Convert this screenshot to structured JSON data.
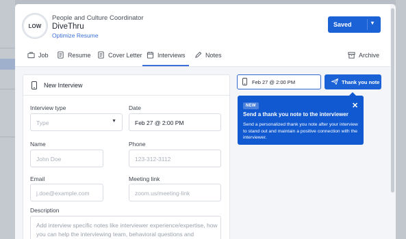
{
  "header": {
    "avatar_text": "LOW",
    "job_title": "People and Culture Coordinator",
    "company": "DiveThru",
    "optimize_link": "Optimize Resume",
    "status_button": "Saved"
  },
  "tabs": [
    {
      "label": "Job",
      "icon": "briefcase-icon"
    },
    {
      "label": "Resume",
      "icon": "document-icon"
    },
    {
      "label": "Cover Letter",
      "icon": "document-icon"
    },
    {
      "label": "Interviews",
      "icon": "calendar-icon",
      "active": true
    },
    {
      "label": "Notes",
      "icon": "pencil-icon"
    },
    {
      "label": "Archive",
      "icon": "archive-icon"
    }
  ],
  "form": {
    "title": "New Interview",
    "interview_type": {
      "label": "Interview type",
      "placeholder": "Type"
    },
    "date": {
      "label": "Date",
      "value": "Feb 27 @ 2:00 PM"
    },
    "name": {
      "label": "Name",
      "placeholder": "John Doe"
    },
    "phone": {
      "label": "Phone",
      "placeholder": "123-312-3112"
    },
    "email": {
      "label": "Email",
      "placeholder": "j.doe@example.com"
    },
    "meeting_link": {
      "label": "Meeting link",
      "placeholder": "zoom.us/meeting-link"
    },
    "description": {
      "label": "Description",
      "placeholder": "Add interview specific notes like interviewer experience/expertise, how you can help the interviewing team, behavioral questions and answers,"
    }
  },
  "side": {
    "date_value": "Feb 27 @ 2:00 PM",
    "thank_you_button": "Thank you note"
  },
  "tooltip": {
    "badge": "NEW",
    "title": "Send a thank you note to the interviewer",
    "body": "Send a personalized thank you note after your interview to stand out and maintain a positive connection with the interviewer."
  },
  "colors": {
    "accent": "#1a62d6",
    "tooltip_bg": "#1059d1",
    "link": "#3a6fd8"
  }
}
